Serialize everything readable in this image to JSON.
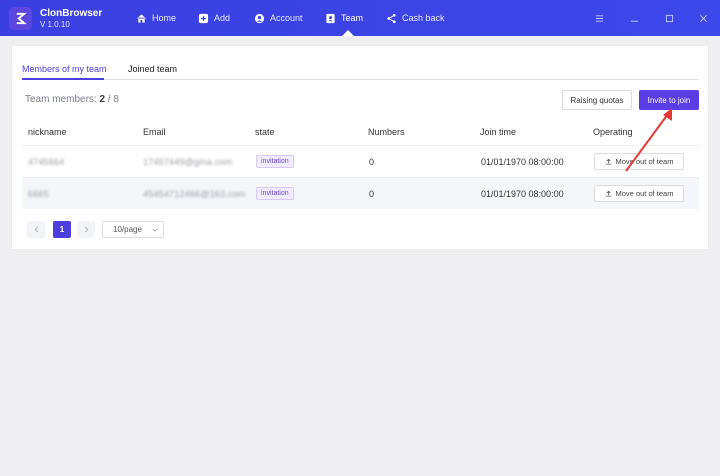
{
  "app": {
    "name": "ClonBrowser",
    "version": "V 1.0.10"
  },
  "nav": [
    {
      "label": "Home",
      "icon": "home-icon"
    },
    {
      "label": "Add",
      "icon": "plus-square-icon"
    },
    {
      "label": "Account",
      "icon": "user-circle-icon"
    },
    {
      "label": "Team",
      "icon": "team-icon"
    },
    {
      "label": "Cash back",
      "icon": "share-icon"
    }
  ],
  "window_controls": [
    "menu-icon",
    "minimize-icon",
    "maximize-icon",
    "close-icon"
  ],
  "tabs": {
    "members": "Members of my team",
    "joined": "Joined team"
  },
  "team": {
    "label": "Team members:",
    "current": "2",
    "separator": " / ",
    "max": "8"
  },
  "buttons": {
    "raise": "Raising quotas",
    "invite": "Invite to join"
  },
  "table": {
    "headers": [
      "nickname",
      "Email",
      "state",
      "Numbers",
      "Join time",
      "Operating"
    ],
    "rows": [
      {
        "nickname": "4745664",
        "email": "17457449@gma.com",
        "state": "invitation",
        "numbers": "0",
        "join_time": "01/01/1970 08:00:00",
        "action": "Move out of team"
      },
      {
        "nickname": "6665",
        "email": "45454712466@163.com",
        "state": "invitation",
        "numbers": "0",
        "join_time": "01/01/1970 08:00:00",
        "action": "Move out of team"
      }
    ]
  },
  "pagination": {
    "current": "1",
    "page_size": "10/page"
  },
  "colors": {
    "primary": "#5b3de6",
    "titlebar": "#3a3fe0",
    "annotation": "#e53935"
  }
}
